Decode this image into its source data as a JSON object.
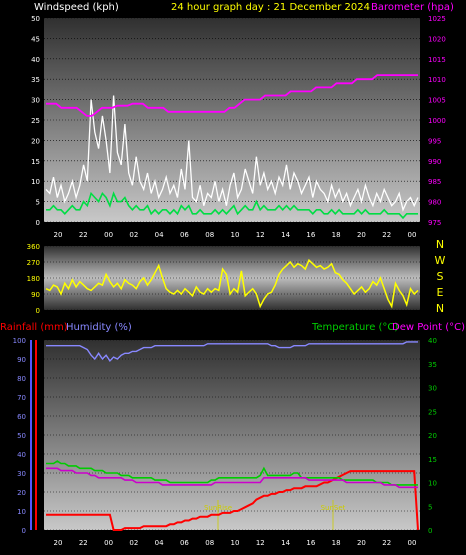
{
  "page": {
    "title": "24 hour graph day : 21 December 2024"
  },
  "chart_data": [
    {
      "type": "line",
      "series": [
        {
          "name": "Windspeed (kph)",
          "color": "#ffffff",
          "values": [
            8,
            7,
            11,
            6,
            9,
            5,
            7,
            10,
            6,
            9,
            14,
            10,
            30,
            22,
            18,
            26,
            20,
            12,
            31,
            17,
            14,
            24,
            12,
            9,
            16,
            10,
            8,
            12,
            7,
            10,
            6,
            8,
            11,
            7,
            9,
            6,
            13,
            8,
            20,
            6,
            5,
            9,
            4,
            7,
            6,
            10,
            5,
            8,
            4,
            9,
            12,
            6,
            8,
            13,
            10,
            7,
            16,
            9,
            12,
            8,
            10,
            7,
            11,
            9,
            14,
            8,
            12,
            10,
            7,
            9,
            11,
            6,
            10,
            8,
            7,
            5,
            9,
            6,
            8,
            5,
            7,
            4,
            6,
            8,
            5,
            9,
            6,
            4,
            7,
            5,
            8,
            6,
            4,
            5,
            7,
            3,
            5,
            6,
            4,
            6
          ]
        },
        {
          "name": "Wind average",
          "color": "#00dd44",
          "values": [
            3,
            3,
            4,
            3,
            3,
            2,
            3,
            4,
            3,
            3,
            5,
            4,
            7,
            6,
            5,
            7,
            6,
            4,
            7,
            5,
            5,
            6,
            4,
            3,
            4,
            3,
            3,
            4,
            2,
            3,
            2,
            3,
            3,
            2,
            3,
            2,
            4,
            3,
            4,
            2,
            2,
            3,
            2,
            2,
            2,
            3,
            2,
            3,
            2,
            3,
            4,
            2,
            3,
            4,
            3,
            3,
            5,
            3,
            4,
            3,
            3,
            3,
            4,
            3,
            4,
            3,
            4,
            3,
            3,
            3,
            3,
            2,
            3,
            3,
            2,
            2,
            3,
            2,
            3,
            2,
            2,
            2,
            2,
            3,
            2,
            3,
            2,
            2,
            2,
            2,
            3,
            2,
            2,
            2,
            2,
            1,
            2,
            2,
            2,
            2
          ]
        },
        {
          "name": "Barometer (hpa)",
          "color": "#ff00ff",
          "values": [
            1004,
            1004,
            1004,
            1003,
            1003,
            1003,
            1003,
            1002,
            1001,
            1001,
            1002,
            1003,
            1003,
            1003,
            1003.5,
            1003.5,
            1003.5,
            1004,
            1004,
            1004,
            1003,
            1003,
            1003,
            1003,
            1002,
            1002,
            1002,
            1002,
            1002,
            1002,
            1002,
            1002,
            1002,
            1002,
            1002,
            1002,
            1003,
            1003,
            1004,
            1005,
            1005,
            1005,
            1005,
            1006,
            1006,
            1006,
            1006,
            1006,
            1007,
            1007,
            1007,
            1007,
            1007,
            1008,
            1008,
            1008,
            1008,
            1009,
            1009,
            1009,
            1009,
            1010,
            1010,
            1010,
            1010,
            1011,
            1011,
            1011,
            1011,
            1011,
            1011,
            1011,
            1011,
            1011
          ]
        }
      ],
      "x_tick_labels": [
        "20",
        "22",
        "00",
        "02",
        "04",
        "06",
        "08",
        "10",
        "12",
        "14",
        "16",
        "18",
        "20",
        "22",
        "00"
      ],
      "left_axis": {
        "label": "Windspeed (kph)",
        "ticks": [
          "0",
          "5",
          "10",
          "15",
          "20",
          "25",
          "30",
          "35",
          "40",
          "45",
          "50"
        ],
        "range": [
          0,
          50
        ]
      },
      "right_axis": {
        "label": "Barometer (hpa)",
        "ticks": [
          "975",
          "980",
          "985",
          "990",
          "995",
          "1000",
          "1005",
          "1010",
          "1015",
          "1020",
          "1025"
        ],
        "range": [
          975,
          1025
        ]
      }
    },
    {
      "type": "line",
      "series": [
        {
          "name": "Wind direction",
          "color": "#ffff00",
          "values": [
            120,
            110,
            140,
            130,
            90,
            150,
            120,
            170,
            130,
            160,
            140,
            120,
            110,
            130,
            150,
            140,
            200,
            160,
            130,
            150,
            120,
            170,
            150,
            140,
            120,
            160,
            180,
            140,
            170,
            210,
            250,
            180,
            120,
            100,
            90,
            110,
            90,
            120,
            100,
            80,
            130,
            100,
            90,
            120,
            100,
            120,
            110,
            230,
            200,
            90,
            120,
            100,
            220,
            80,
            100,
            120,
            90,
            20,
            60,
            90,
            100,
            140,
            200,
            230,
            250,
            270,
            240,
            260,
            250,
            230,
            280,
            260,
            240,
            250,
            230,
            240,
            260,
            210,
            200,
            170,
            150,
            120,
            90,
            110,
            130,
            100,
            120,
            160,
            140,
            180,
            120,
            60,
            20,
            150,
            110,
            80,
            30,
            120,
            90,
            110
          ]
        }
      ],
      "x_tick_labels": [
        "20",
        "22",
        "00",
        "02",
        "04",
        "06",
        "08",
        "10",
        "12",
        "14",
        "16",
        "18",
        "20",
        "22",
        "00"
      ],
      "left_axis": {
        "ticks": [
          "0",
          "90",
          "180",
          "270",
          "360"
        ],
        "range": [
          0,
          360
        ]
      },
      "right_axis_labels": [
        "N",
        "W",
        "S",
        "E",
        "N"
      ]
    },
    {
      "type": "line",
      "series": [
        {
          "name": "Humidity (%)",
          "color": "#8888ff",
          "values": [
            97,
            97,
            97,
            97,
            97,
            97,
            97,
            97,
            97,
            97,
            96,
            95,
            92,
            90,
            93,
            90,
            92,
            89,
            91,
            90,
            92,
            93,
            93,
            94,
            94,
            95,
            96,
            96,
            96,
            97,
            97,
            97,
            97,
            97,
            97,
            97,
            97,
            97,
            97,
            97,
            97,
            97,
            97,
            98,
            98,
            98,
            98,
            98,
            98,
            98,
            98,
            98,
            98,
            98,
            98,
            98,
            98,
            98,
            98,
            98,
            97,
            97,
            96,
            96,
            96,
            96,
            97,
            97,
            97,
            97,
            98,
            98,
            98,
            98,
            98,
            98,
            98,
            98,
            98,
            98,
            98,
            98,
            98,
            98,
            98,
            98,
            98,
            98,
            98,
            98,
            98,
            98,
            98,
            98,
            98,
            98,
            99,
            99,
            99,
            99
          ]
        },
        {
          "name": "Rainfall (mm)",
          "color": "#ff0000",
          "values": [
            8,
            8,
            8,
            8,
            8,
            8,
            8,
            8,
            8,
            8,
            8,
            8,
            8,
            8,
            8,
            8,
            8,
            8,
            0,
            0,
            0,
            1,
            1,
            1,
            1,
            1,
            2,
            2,
            2,
            2,
            2,
            2,
            2,
            3,
            3,
            4,
            4,
            5,
            5,
            6,
            6,
            7,
            7,
            7,
            8,
            8,
            8,
            9,
            9,
            9,
            10,
            10,
            11,
            12,
            13,
            14,
            16,
            17,
            18,
            18,
            19,
            19,
            20,
            20,
            21,
            21,
            22,
            22,
            22,
            23,
            23,
            23,
            23,
            24,
            25,
            25,
            26,
            27,
            28,
            29,
            30,
            31,
            31,
            31,
            31,
            31,
            31,
            31,
            31,
            31,
            31,
            31,
            31,
            31,
            31,
            31,
            31,
            31,
            31,
            0
          ]
        },
        {
          "name": "Temperature (°C)",
          "color": "#00cc00",
          "values": [
            14,
            14,
            14,
            14.5,
            14,
            14,
            13.5,
            13.5,
            13.5,
            13,
            13,
            13,
            13,
            12.5,
            12.5,
            12.5,
            12,
            12,
            12,
            12,
            11.5,
            11.5,
            11.5,
            11,
            11,
            11,
            11,
            11,
            11,
            10.5,
            10.5,
            10.5,
            10.5,
            10,
            10,
            10,
            10,
            10,
            10,
            10,
            10,
            10,
            10,
            10,
            10.5,
            10.5,
            11,
            11,
            11,
            11,
            11,
            11,
            11,
            11,
            11,
            11,
            11,
            11.5,
            13,
            11.5,
            11.5,
            11.5,
            11.5,
            11.5,
            11.5,
            11.5,
            12,
            12,
            11,
            11,
            11,
            11,
            11,
            11,
            11,
            11,
            11,
            11,
            11,
            10.5,
            10.5,
            10.5,
            10.5,
            10.5,
            10.5,
            10.5,
            10.5,
            10.5,
            10,
            10,
            10,
            10,
            9.5,
            9.5,
            9.5,
            9.5,
            9.5,
            9.5,
            9.5,
            9.5
          ]
        },
        {
          "name": "Dew Point (°C)",
          "color": "#cc00cc",
          "values": [
            13,
            13,
            13,
            13,
            12.5,
            12.5,
            12.5,
            12.5,
            12,
            12,
            12,
            12,
            11.5,
            11.5,
            11,
            11,
            11,
            11,
            11,
            11,
            11,
            10.5,
            10.5,
            10.5,
            10,
            10,
            10,
            10,
            10,
            10,
            10,
            9.5,
            9.5,
            9.5,
            9.5,
            9.5,
            9.5,
            9.5,
            9.5,
            9.5,
            9.5,
            9.5,
            9.5,
            9.5,
            9.5,
            10,
            10,
            10,
            10,
            10,
            10,
            10,
            10,
            10,
            10,
            10,
            10,
            10,
            11,
            11,
            11,
            11,
            11,
            11,
            11,
            11,
            11,
            11,
            11,
            11,
            10.5,
            10.5,
            10.5,
            10.5,
            10.5,
            10.5,
            10.5,
            10.5,
            10.5,
            10.5,
            10,
            10,
            10,
            10,
            10,
            10,
            10,
            10,
            10,
            10,
            9.5,
            9.5,
            9.5,
            9.5,
            9,
            9,
            9,
            9,
            9,
            9
          ]
        }
      ],
      "markers": [
        {
          "label": "SunRise",
          "color": "#cccc00"
        },
        {
          "label": "SunSet",
          "color": "#cccc00"
        }
      ],
      "x_tick_labels": [
        "20",
        "22",
        "00",
        "02",
        "04",
        "06",
        "08",
        "10",
        "12",
        "14",
        "16",
        "18",
        "20",
        "22",
        "00"
      ],
      "left_axis": {
        "label1": "Rainfall (mm)",
        "label2": "Humidity (%)",
        "ticks": [
          "0",
          "10",
          "20",
          "30",
          "40",
          "50",
          "60",
          "70",
          "80",
          "90",
          "100"
        ],
        "range": [
          0,
          100
        ]
      },
      "right_axis": {
        "label1": "Temperature (°C)",
        "label2": "Dew Point (°C)",
        "ticks": [
          "0",
          "5",
          "10",
          "15",
          "20",
          "25",
          "30",
          "35",
          "40"
        ],
        "range": [
          0,
          40
        ]
      }
    }
  ]
}
